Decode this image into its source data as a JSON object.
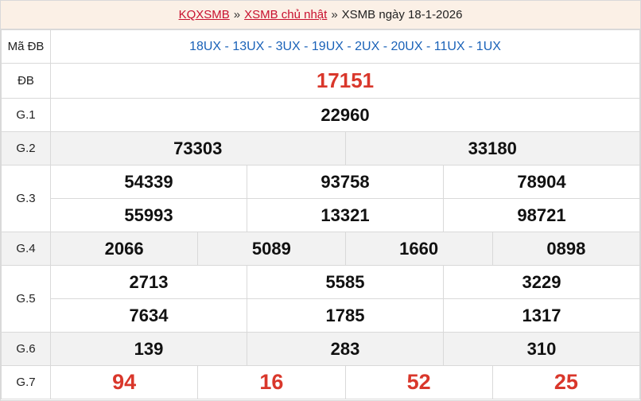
{
  "breadcrumb": {
    "link1": "KQXSMB",
    "link2": "XSMB chủ nhật",
    "separator": "»",
    "current": "XSMB ngày 18-1-2026"
  },
  "table": {
    "ma_db": {
      "label": "Mã ĐB",
      "codes": "18UX - 13UX - 3UX - 19UX - 2UX - 20UX - 11UX - 1UX"
    },
    "db": {
      "label": "ĐB",
      "value": "17151"
    },
    "g1": {
      "label": "G.1",
      "values": [
        "22960"
      ]
    },
    "g2": {
      "label": "G.2",
      "values": [
        "73303",
        "33180"
      ]
    },
    "g3": {
      "label": "G.3",
      "values": [
        "54339",
        "93758",
        "78904",
        "55993",
        "13321",
        "98721"
      ]
    },
    "g4": {
      "label": "G.4",
      "values": [
        "2066",
        "5089",
        "1660",
        "0898"
      ]
    },
    "g5": {
      "label": "G.5",
      "values": [
        "2713",
        "5585",
        "3229",
        "7634",
        "1785",
        "1317"
      ]
    },
    "g6": {
      "label": "G.6",
      "values": [
        "139",
        "283",
        "310"
      ]
    },
    "g7": {
      "label": "G.7",
      "values": [
        "94",
        "16",
        "52",
        "25"
      ]
    }
  },
  "colors": {
    "accent_red": "#d9372b",
    "link_blue": "#1a62b8",
    "header_bg": "#fbf0e6"
  }
}
